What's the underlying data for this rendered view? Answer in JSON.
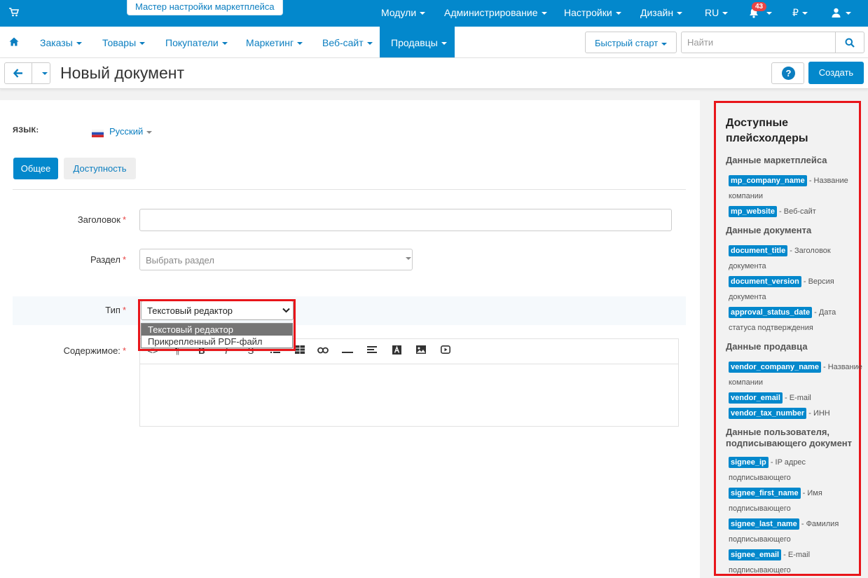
{
  "header": {
    "wizard_label": "Мастер настройки маркетплейса",
    "menu": [
      "Модули",
      "Администрирование",
      "Настройки",
      "Дизайн",
      "RU"
    ],
    "notifications_count": "43",
    "currency": "₽"
  },
  "main_nav": {
    "items": [
      "Заказы",
      "Товары",
      "Покупатели",
      "Маркетинг",
      "Веб-сайт"
    ],
    "active": "Продавцы",
    "quick_start": "Быстрый старт",
    "search_placeholder": "Найти"
  },
  "page": {
    "title": "Новый документ",
    "create_label": "Создать",
    "help_glyph": "?"
  },
  "form": {
    "language_label": "ЯЗЫК:",
    "language_value": "Русский",
    "tabs": [
      "Общее",
      "Доступность"
    ],
    "title_label": "Заголовок",
    "section_label": "Раздел",
    "section_placeholder": "Выбрать раздел",
    "type_label": "Тип",
    "type_value": "Текстовый редактор",
    "type_options": [
      "Текстовый редактор",
      "Прикрепленный PDF-файл"
    ],
    "content_label": "Содержимое:",
    "required_mark": "*"
  },
  "sidebar": {
    "title": "Доступные плейсхолдеры",
    "groups": [
      {
        "title": "Данные маркетплейса",
        "items": [
          {
            "key": "mp_company_name",
            "desc": "- Название",
            "desc2": "компании"
          },
          {
            "key": "mp_website",
            "desc": "- Веб-сайт"
          }
        ]
      },
      {
        "title": "Данные документа",
        "items": [
          {
            "key": "document_title",
            "desc": "- Заголовок",
            "desc2": "документа"
          },
          {
            "key": "document_version",
            "desc": "- Версия",
            "desc2": "документа"
          },
          {
            "key": "approval_status_date",
            "desc": "- Дата",
            "desc2": "статуса подтверждения"
          }
        ]
      },
      {
        "title": "Данные продавца",
        "items": [
          {
            "key": "vendor_company_name",
            "desc": "- Название",
            "desc2": "компании"
          },
          {
            "key": "vendor_email",
            "desc": "- E-mail"
          },
          {
            "key": "vendor_tax_number",
            "desc": "- ИНН"
          }
        ]
      },
      {
        "title": "Данные пользователя, подписывающего документ",
        "items": [
          {
            "key": "signee_ip",
            "desc": "- IP адрес",
            "desc2": "подписывающего"
          },
          {
            "key": "signee_first_name",
            "desc": "- Имя",
            "desc2": "подписывающего"
          },
          {
            "key": "signee_last_name",
            "desc": "- Фамилия",
            "desc2": "подписывающего"
          },
          {
            "key": "signee_email",
            "desc": "- E-mail",
            "desc2": "подписывающего"
          }
        ]
      }
    ]
  },
  "colors": {
    "primary": "#0388cc",
    "highlight_border": "#e8151a",
    "badge": "#e84545"
  }
}
